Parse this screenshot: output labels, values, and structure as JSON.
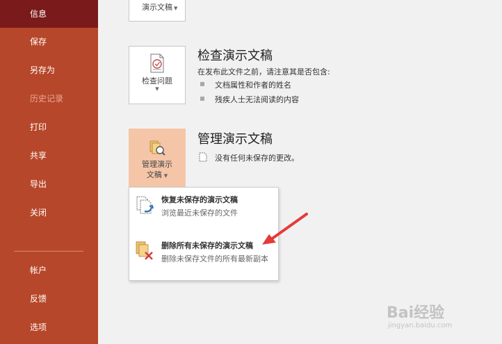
{
  "sidebar": {
    "items": [
      {
        "label": "信息"
      },
      {
        "label": "保存"
      },
      {
        "label": "另存为"
      },
      {
        "label": "历史记录"
      },
      {
        "label": "打印"
      },
      {
        "label": "共享"
      },
      {
        "label": "导出"
      },
      {
        "label": "关闭"
      },
      {
        "label": "帐户"
      },
      {
        "label": "反馈"
      },
      {
        "label": "选项"
      }
    ]
  },
  "main": {
    "top_button": {
      "label": "演示文稿"
    },
    "inspect": {
      "button_label": "检查问题",
      "title": "检查演示文稿",
      "intro": "在发布此文件之前，请注意其是否包含:",
      "bullets": [
        "文档属性和作者的姓名",
        "残疾人士无法阅读的内容"
      ]
    },
    "manage": {
      "button_line1": "管理演示",
      "button_line2": "文稿",
      "title": "管理演示文稿",
      "status": "没有任何未保存的更改。"
    }
  },
  "menu": {
    "items": [
      {
        "title": "恢复未保存的演示文稿",
        "desc": "浏览最近未保存的文件"
      },
      {
        "title": "删除所有未保存的演示文稿",
        "desc": "删除未保存文件的所有最新副本"
      }
    ]
  },
  "watermark": {
    "brand": "Bai经验",
    "url": "jingyan.baidu.com"
  },
  "colors": {
    "sidebar": "#b7472a",
    "sidebar_active": "#7a1a1a",
    "pressed": "#f5c5a8",
    "arrow": "#e63a3a"
  }
}
